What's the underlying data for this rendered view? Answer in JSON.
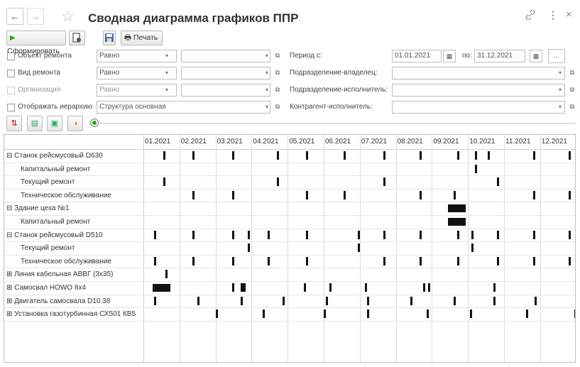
{
  "header": {
    "title": "Сводная диаграмма графиков ППР",
    "back_icon": "←",
    "forward_icon": "→",
    "star_icon": "☆",
    "link_icon": "🔗",
    "more_icon": "⋮",
    "close_icon": "×"
  },
  "toolbar": {
    "generate_label": "Сформировать",
    "print_label": "Печать"
  },
  "filters": {
    "object": {
      "label": "Объект ремонта",
      "condition": "Равно",
      "value": ""
    },
    "repair_type": {
      "label": "Вид ремонта",
      "condition": "Равно",
      "value": ""
    },
    "organization": {
      "label": "Организация",
      "condition": "Равно",
      "value": ""
    },
    "hierarchy": {
      "label": "Отображать иерархию",
      "value": "Структура основная"
    },
    "period_label": "Период с:",
    "period_from": "01.01.2021",
    "period_to_label": "по:",
    "period_to": "31.12.2021",
    "period_more": "...",
    "owner_label": "Подразделение-владелец:",
    "executor_label": "Подразделение-исполнитель:",
    "contractor_label": "Контрагент-исполнитель:"
  },
  "months": [
    "01.2021",
    "02.2021",
    "03.2021",
    "04.2021",
    "05.2021",
    "06.2021",
    "07.2021",
    "08.2021",
    "09.2021",
    "10.2021",
    "11.2021",
    "12.2021"
  ],
  "rows": [
    {
      "label": "⊟ Станок рейсмусовый D630",
      "indent": 0,
      "marks": [
        [
          0.55,
          "t"
        ],
        [
          1.35,
          "t"
        ],
        [
          2.45,
          "t"
        ],
        [
          3.7,
          "t"
        ],
        [
          4.5,
          "t"
        ],
        [
          5.55,
          "t"
        ],
        [
          6.65,
          "t"
        ],
        [
          7.65,
          "t"
        ],
        [
          8.7,
          "t"
        ],
        [
          9.2,
          "t"
        ],
        [
          9.55,
          "t"
        ],
        [
          10.8,
          "t"
        ],
        [
          11.8,
          "t"
        ]
      ]
    },
    {
      "label": "Капитальный ремонт",
      "indent": 1,
      "marks": [
        [
          9.2,
          "t"
        ]
      ]
    },
    {
      "label": "Текущий ремонт",
      "indent": 1,
      "marks": [
        [
          0.55,
          "t"
        ],
        [
          3.7,
          "t"
        ],
        [
          6.65,
          "t"
        ],
        [
          9.8,
          "t"
        ]
      ]
    },
    {
      "label": "Техническое обслуживание",
      "indent": 1,
      "marks": [
        [
          1.35,
          "t"
        ],
        [
          2.45,
          "t"
        ],
        [
          4.5,
          "t"
        ],
        [
          5.55,
          "t"
        ],
        [
          7.65,
          "t"
        ],
        [
          8.6,
          "t"
        ],
        [
          10.8,
          "t"
        ],
        [
          11.8,
          "t"
        ]
      ]
    },
    {
      "label": "⊟ Здание цеха №1",
      "indent": 0,
      "marks": [
        [
          8.45,
          "w"
        ]
      ]
    },
    {
      "label": "Капитальный ремонт",
      "indent": 1,
      "marks": [
        [
          8.45,
          "w"
        ]
      ]
    },
    {
      "label": "⊟ Станок рейсмусовый D510",
      "indent": 0,
      "marks": [
        [
          0.3,
          "t"
        ],
        [
          1.35,
          "t"
        ],
        [
          2.45,
          "t"
        ],
        [
          2.9,
          "t"
        ],
        [
          3.45,
          "t"
        ],
        [
          4.5,
          "t"
        ],
        [
          5.95,
          "t"
        ],
        [
          6.65,
          "t"
        ],
        [
          7.65,
          "t"
        ],
        [
          8.7,
          "t"
        ],
        [
          9.1,
          "t"
        ],
        [
          9.8,
          "t"
        ],
        [
          10.8,
          "t"
        ],
        [
          11.8,
          "t"
        ]
      ]
    },
    {
      "label": "Текущий ремонт",
      "indent": 1,
      "marks": [
        [
          2.9,
          "t"
        ],
        [
          5.95,
          "t"
        ],
        [
          9.1,
          "t"
        ]
      ]
    },
    {
      "label": "Техническое обслуживание",
      "indent": 1,
      "marks": [
        [
          0.3,
          "t"
        ],
        [
          1.35,
          "t"
        ],
        [
          2.45,
          "t"
        ],
        [
          3.45,
          "t"
        ],
        [
          4.5,
          "t"
        ],
        [
          6.65,
          "t"
        ],
        [
          7.65,
          "t"
        ],
        [
          8.7,
          "t"
        ],
        [
          9.8,
          "t"
        ],
        [
          10.8,
          "t"
        ],
        [
          11.8,
          "t"
        ]
      ]
    },
    {
      "label": "⊞ Линия кабельная АВВГ (3х35)",
      "indent": 0,
      "marks": [
        [
          0.6,
          "t"
        ]
      ]
    },
    {
      "label": "⊞ Самосвал HOWO 8x4",
      "indent": 0,
      "marks": [
        [
          0.25,
          "w"
        ],
        [
          2.45,
          "t"
        ],
        [
          2.7,
          "m"
        ],
        [
          4.45,
          "t"
        ],
        [
          5.15,
          "t"
        ],
        [
          6.15,
          "t"
        ],
        [
          7.75,
          "t"
        ],
        [
          7.9,
          "t"
        ],
        [
          9.7,
          "t"
        ]
      ]
    },
    {
      "label": "⊞ Двигатель самосвала D10.38",
      "indent": 0,
      "marks": [
        [
          0.3,
          "t"
        ],
        [
          1.5,
          "t"
        ],
        [
          2.7,
          "t"
        ],
        [
          3.85,
          "t"
        ],
        [
          5.05,
          "t"
        ],
        [
          6.2,
          "t"
        ],
        [
          7.4,
          "t"
        ],
        [
          8.6,
          "t"
        ],
        [
          9.7,
          "t"
        ],
        [
          10.85,
          "t"
        ]
      ]
    },
    {
      "label": "⊞ Установка газотурбинная СХ501 КВ5",
      "indent": 0,
      "marks": [
        [
          2.0,
          "t"
        ],
        [
          3.3,
          "t"
        ],
        [
          5.0,
          "t"
        ],
        [
          6.2,
          "t"
        ],
        [
          7.85,
          "t"
        ],
        [
          9.05,
          "t"
        ],
        [
          10.6,
          "t"
        ],
        [
          11.95,
          "t"
        ]
      ]
    }
  ],
  "colors": {
    "accent": "#1fb100",
    "bar": "#111111",
    "grid": "#dcdcdc"
  }
}
